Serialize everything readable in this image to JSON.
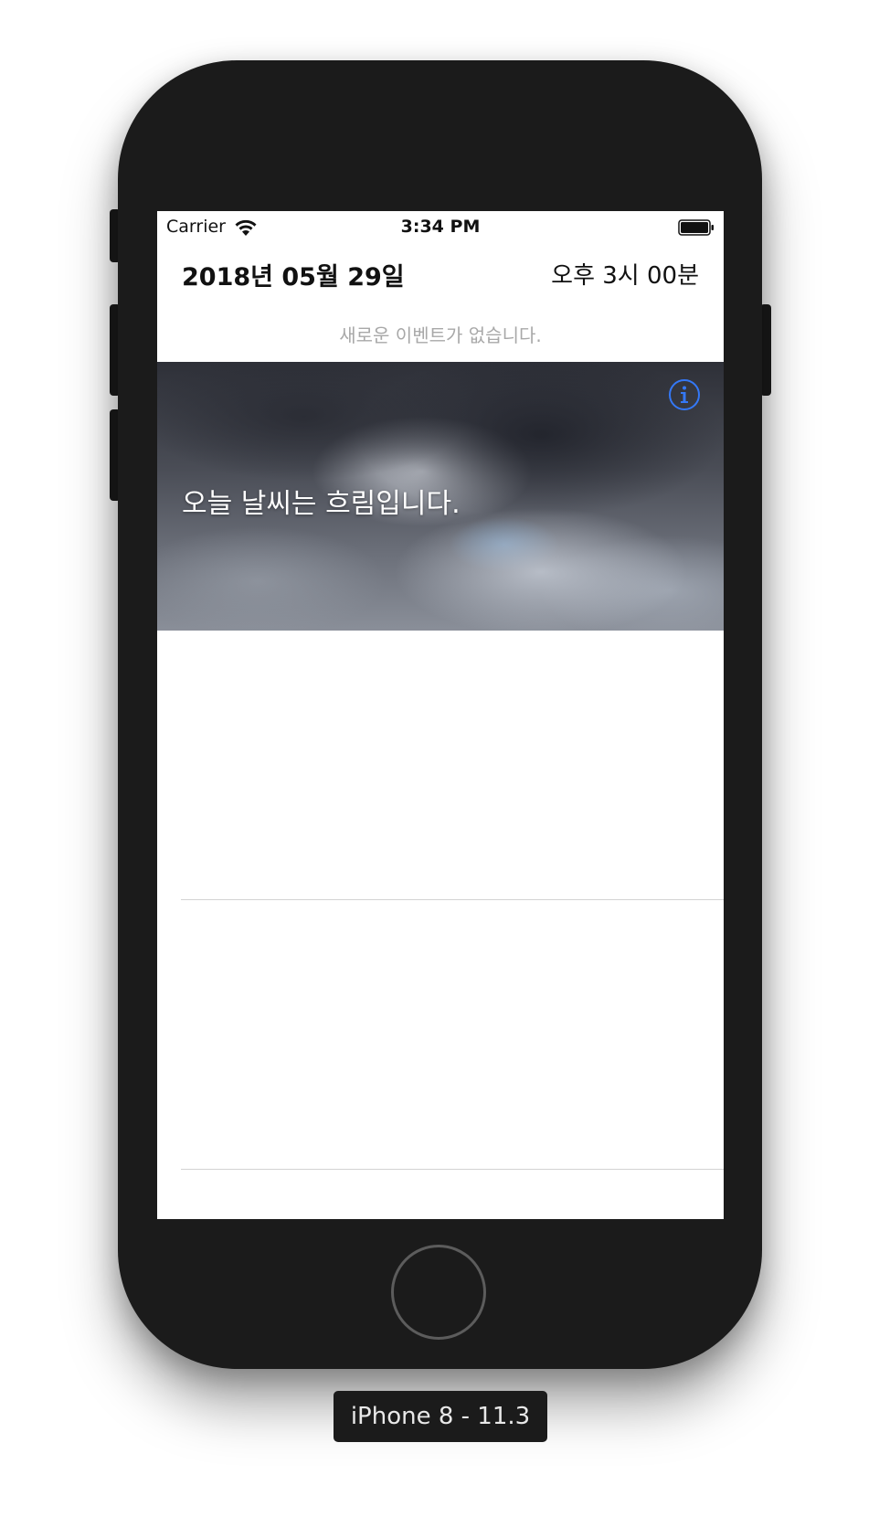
{
  "status_bar": {
    "carrier": "Carrier",
    "time": "3:34 PM",
    "wifi_icon": "wifi-icon",
    "battery_icon": "battery-icon"
  },
  "header": {
    "date": "2018년 05월 29일",
    "time": "오후 3시 00분"
  },
  "events": {
    "empty_message": "새로운 이벤트가 없습니다."
  },
  "weather": {
    "message": "오늘 날씨는 흐림입니다.",
    "info_icon": "info-icon",
    "accent_color": "#3478F6"
  },
  "simulator": {
    "device_label": "iPhone 8 - 11.3",
    "home_button_icon": "home-button-icon"
  }
}
